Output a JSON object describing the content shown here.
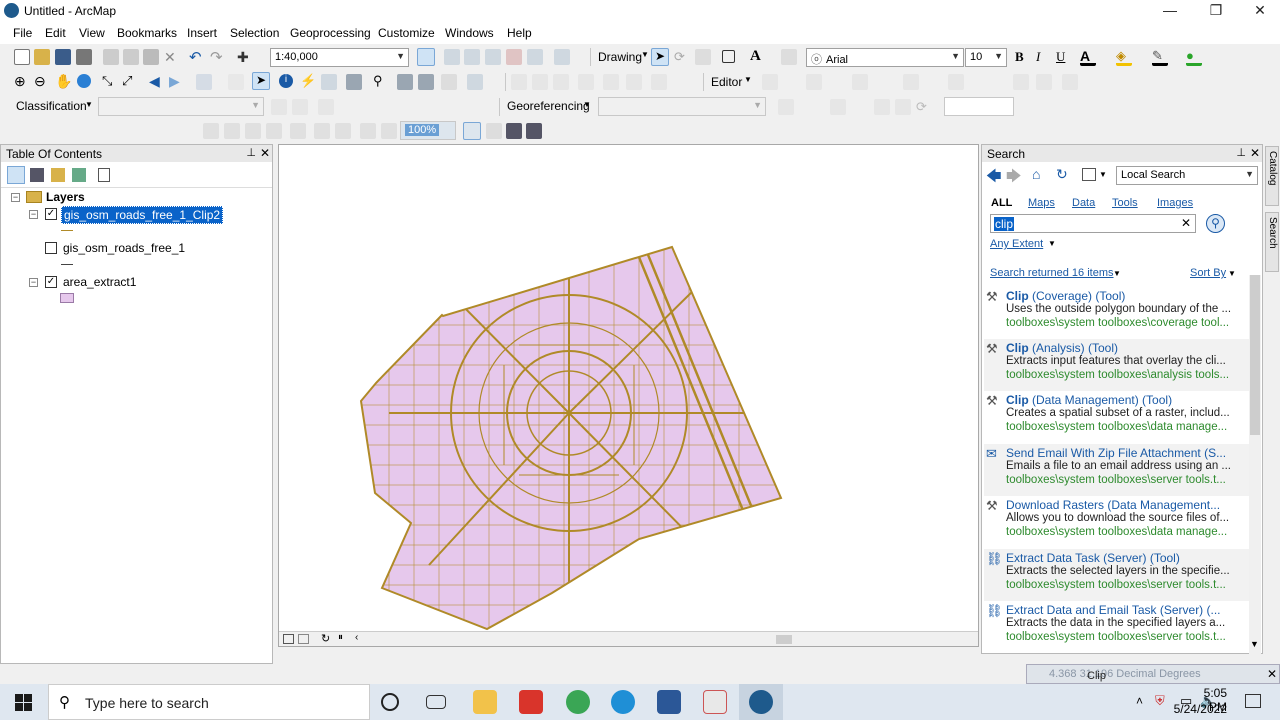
{
  "window": {
    "title": "Untitled - ArcMap",
    "minimize": "—",
    "maximize": "❐",
    "close": "✕"
  },
  "menu": [
    "File",
    "Edit",
    "View",
    "Bookmarks",
    "Insert",
    "Selection",
    "Geoprocessing",
    "Customize",
    "Windows",
    "Help"
  ],
  "toolbar": {
    "scale": "1:40,000",
    "drawing_label": "Drawing",
    "font_name": "Arial",
    "font_size": "10",
    "bold": "B",
    "italic": "I",
    "underline": "U",
    "editor_label": "Editor",
    "classification_label": "Classification",
    "georeferencing_label": "Georeferencing",
    "zoom_value": "100%"
  },
  "toc": {
    "title": "Table Of Contents",
    "root": "Layers",
    "layers": [
      {
        "name": "gis_osm_roads_free_1_Clip2",
        "checked": true,
        "selected": true
      },
      {
        "name": "gis_osm_roads_free_1",
        "checked": false,
        "selected": false
      },
      {
        "name": "area_extract1",
        "checked": true,
        "selected": false
      }
    ]
  },
  "search": {
    "title": "Search",
    "scope": "Local Search",
    "tabs": [
      "ALL",
      "Maps",
      "Data",
      "Tools",
      "Images"
    ],
    "query": "clip",
    "extent": "Any Extent",
    "count_text": "Search returned 16 items",
    "sort_text": "Sort By",
    "results": [
      {
        "title": "Clip",
        "suffix": " (Coverage) (Tool)",
        "desc": "Uses the outside polygon boundary of the ...",
        "path": "toolboxes\\system toolboxes\\coverage tool..."
      },
      {
        "title": "Clip",
        "suffix": " (Analysis) (Tool)",
        "desc": "Extracts input features that overlay the cli...",
        "path": "toolboxes\\system toolboxes\\analysis tools..."
      },
      {
        "title": "Clip",
        "suffix": " (Data Management) (Tool)",
        "desc": "Creates a spatial subset of a raster, includ...",
        "path": "toolboxes\\system toolboxes\\data manage..."
      },
      {
        "title": "Send Email With Zip File Attachment (S...",
        "suffix": "",
        "desc": "Emails a file to an email address using an ...",
        "path": "toolboxes\\system toolboxes\\server tools.t..."
      },
      {
        "title": "Download Rasters (Data Management...",
        "suffix": "",
        "desc": "Allows you to download the source files of...",
        "path": "toolboxes\\system toolboxes\\data manage..."
      },
      {
        "title": "Extract Data Task (Server) (Tool)",
        "suffix": "",
        "desc": "Extracts the selected layers in the specifie...",
        "path": "toolboxes\\system toolboxes\\server tools.t..."
      },
      {
        "title": "Extract Data and Email Task (Server) (...",
        "suffix": "",
        "desc": "Extracts the data in the specified layers a...",
        "path": "toolboxes\\system toolboxes\\server tools.t..."
      }
    ],
    "side_tabs": [
      "Catalog",
      "Search"
    ]
  },
  "status": {
    "coords": "4.368  31.196 Decimal Degrees",
    "drag_text": "Clip"
  },
  "taskbar": {
    "search_placeholder": "Type here to search",
    "time": "5:05 PM",
    "date": "5/24/2022"
  },
  "colors": {
    "polygon_fill": "#e6c8ec",
    "road_stroke": "#b08a28",
    "accent": "#0a63c9"
  }
}
